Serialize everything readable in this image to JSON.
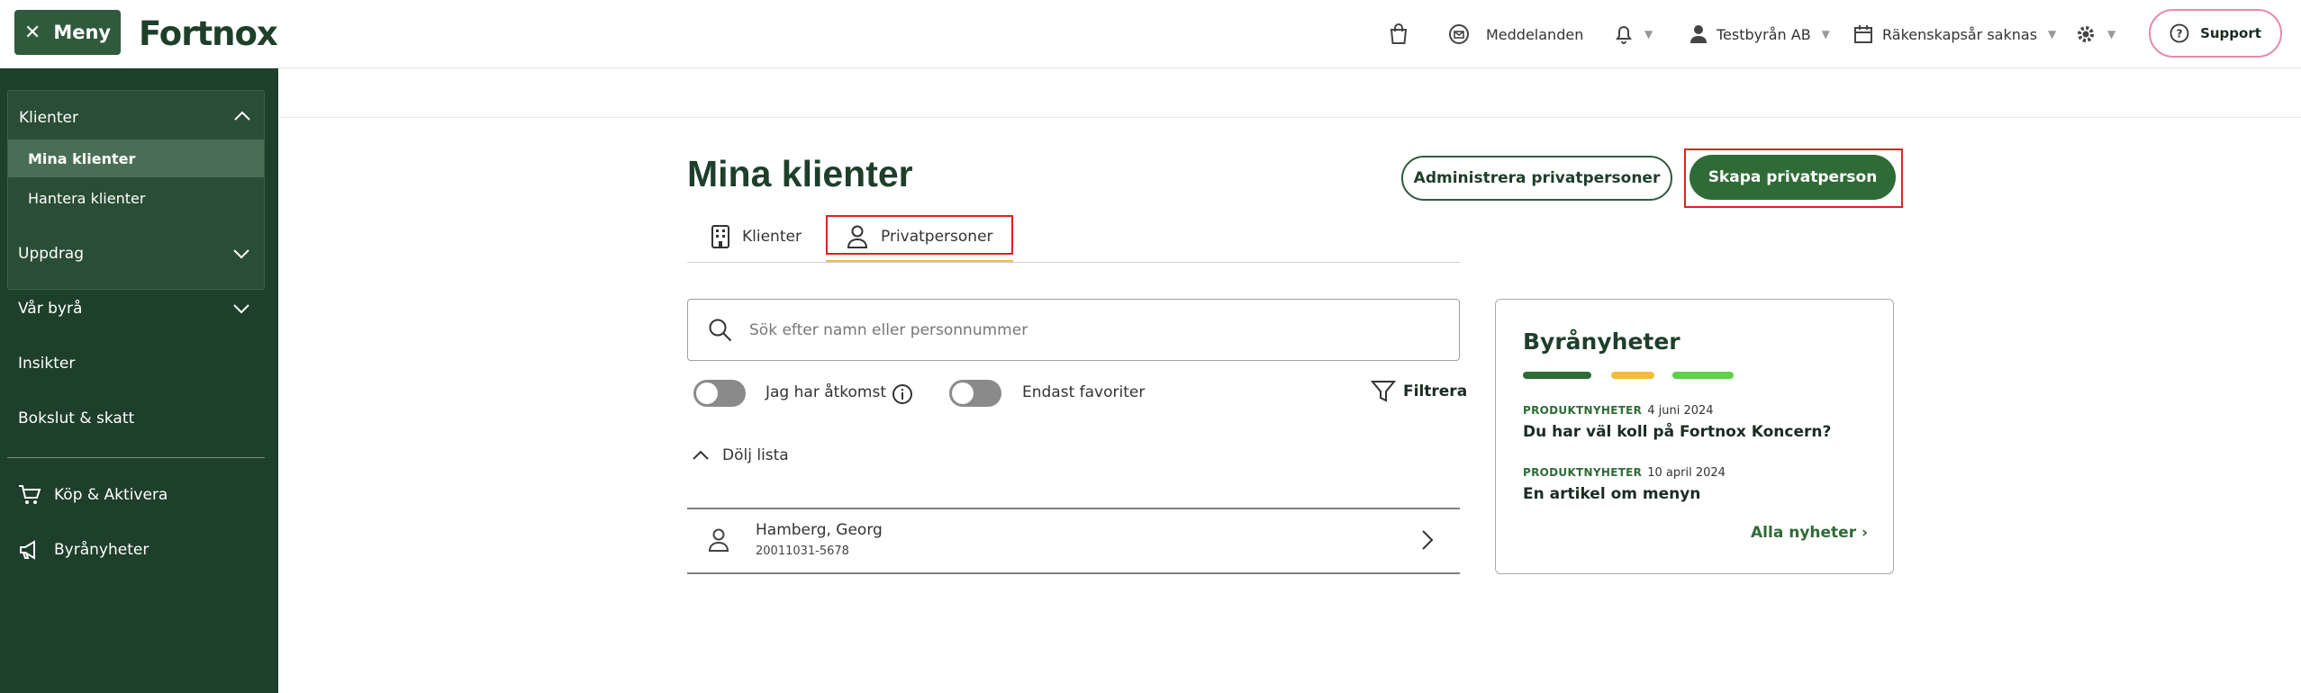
{
  "header": {
    "menu_label": "Meny",
    "logo_text": "Fortnox",
    "messages_label": "Meddelanden",
    "company_label": "Testbyrån AB",
    "fiscal_label": "Räkenskapsår saknas",
    "support_label": "Support"
  },
  "sidebar": {
    "group_title": "Klienter",
    "group_items": [
      {
        "label": "Mina klienter",
        "active": true
      },
      {
        "label": "Hantera klienter",
        "active": false
      }
    ],
    "items": [
      {
        "label": "Uppdrag"
      },
      {
        "label": "Vår byrå"
      },
      {
        "label": "Insikter"
      },
      {
        "label": "Bokslut & skatt"
      }
    ],
    "bottom_items": [
      {
        "label": "Köp & Aktivera",
        "icon": "cart-icon"
      },
      {
        "label": "Byrånyheter",
        "icon": "megaphone-icon"
      }
    ]
  },
  "main": {
    "title": "Mina klienter",
    "admin_button": "Administrera privatpersoner",
    "create_button": "Skapa privatperson",
    "tabs": [
      {
        "label": "Klienter",
        "icon": "building-icon"
      },
      {
        "label": "Privatpersoner",
        "icon": "person-icon",
        "active": true
      }
    ],
    "search_placeholder": "Sök efter namn eller personnummer",
    "toggle_access_label": "Jag har åtkomst",
    "toggle_favorites_label": "Endast favoriter",
    "filter_label": "Filtrera",
    "collapse_label": "Dölj lista",
    "rows": [
      {
        "name": "Hamberg, Georg",
        "id": "20011031-5678"
      }
    ]
  },
  "news": {
    "title": "Byrånyheter",
    "bar_colors": [
      "#2f6b36",
      "#f2bd3c",
      "#5fd14a"
    ],
    "items": [
      {
        "tag": "PRODUKTNYHETER",
        "date": "4 juni 2024",
        "headline": "Du har väl koll på Fortnox Koncern?"
      },
      {
        "tag": "PRODUKTNYHETER",
        "date": "10 april 2024",
        "headline": "En artikel om menyn"
      }
    ],
    "all_link": "Alla nyheter ›"
  }
}
